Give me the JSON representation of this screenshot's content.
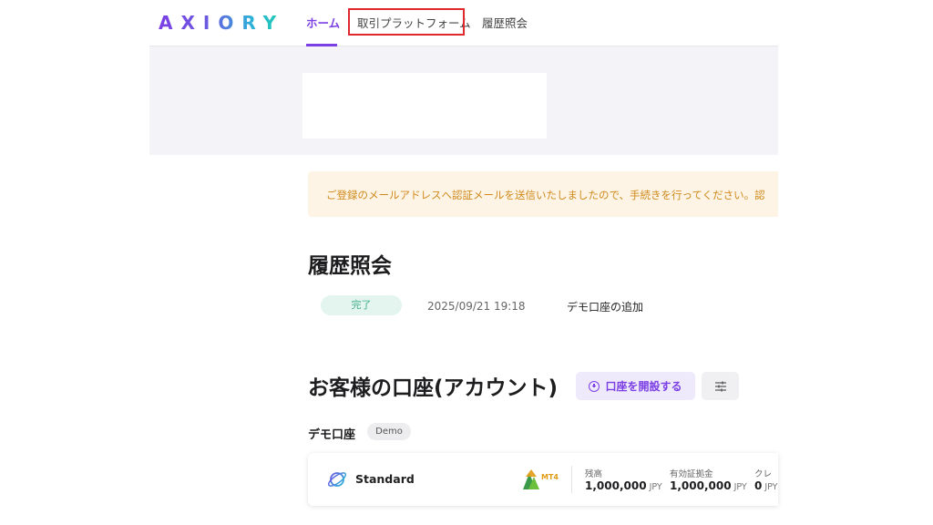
{
  "header": {
    "logo": "AXIORY",
    "nav": {
      "home": "ホーム",
      "platform": "取引プラットフォーム",
      "history": "履歴照会"
    }
  },
  "notice": {
    "text": "ご登録のメールアドレスへ認証メールを送信いたしましたので、手続きを行ってください。認"
  },
  "history": {
    "title": "履歴照会",
    "items": [
      {
        "status": "完了",
        "date": "2025/09/21 19:18",
        "description": "デモ口座の追加"
      }
    ]
  },
  "accounts": {
    "title": "お客様の口座(アカウント)",
    "open_button": "口座を開設する",
    "demo_label": "デモ口座",
    "demo_badge": "Demo",
    "card": {
      "type": "Standard",
      "platform": "MT4",
      "stats": [
        {
          "label": "残高",
          "value": "1,000,000",
          "unit": "JPY"
        },
        {
          "label": "有効証拠金",
          "value": "1,000,000",
          "unit": "JPY"
        },
        {
          "label": "クレ",
          "value": "0",
          "unit": "JPY"
        }
      ]
    }
  },
  "colors": {
    "accent": "#7b3fe4",
    "highlight_box": "#e0292e",
    "notice_text": "#d08a1c",
    "done_badge": "#3fae8a"
  }
}
